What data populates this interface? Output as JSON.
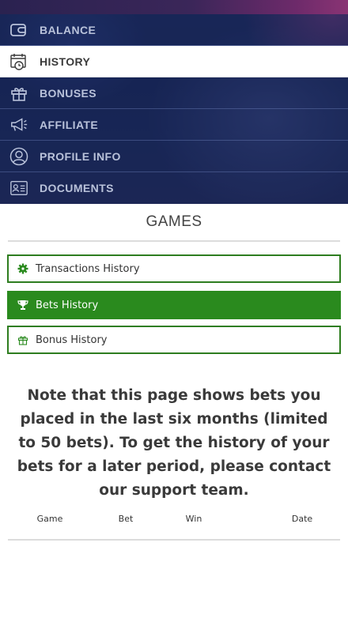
{
  "menu": {
    "items": [
      {
        "label": "BALANCE",
        "icon": "wallet-icon",
        "active": false
      },
      {
        "label": "HISTORY",
        "icon": "calendar-clock-icon",
        "active": true
      },
      {
        "label": "BONUSES",
        "icon": "gift-icon",
        "active": false
      },
      {
        "label": "AFFILIATE",
        "icon": "megaphone-icon",
        "active": false
      },
      {
        "label": "PROFILE INFO",
        "icon": "user-circle-icon",
        "active": false
      },
      {
        "label": "DOCUMENTS",
        "icon": "id-card-icon",
        "active": false
      }
    ]
  },
  "section": {
    "title": "GAMES"
  },
  "history_buttons": [
    {
      "label": "Transactions History",
      "icon": "gear-icon",
      "active": false
    },
    {
      "label": "Bets History",
      "icon": "trophy-icon",
      "active": true
    },
    {
      "label": "Bonus History",
      "icon": "gift-icon",
      "active": false
    }
  ],
  "note": "Note that this page shows bets you placed in the last six months (limited to 50 bets). To get the history of your bets for a later period, please contact our support team.",
  "table": {
    "columns": [
      "Game",
      "Bet",
      "Win",
      "Date"
    ]
  },
  "colors": {
    "accent_green": "#2a8a1e",
    "menu_bg": "#1f2d5c",
    "menu_text": "#b9c2da"
  }
}
